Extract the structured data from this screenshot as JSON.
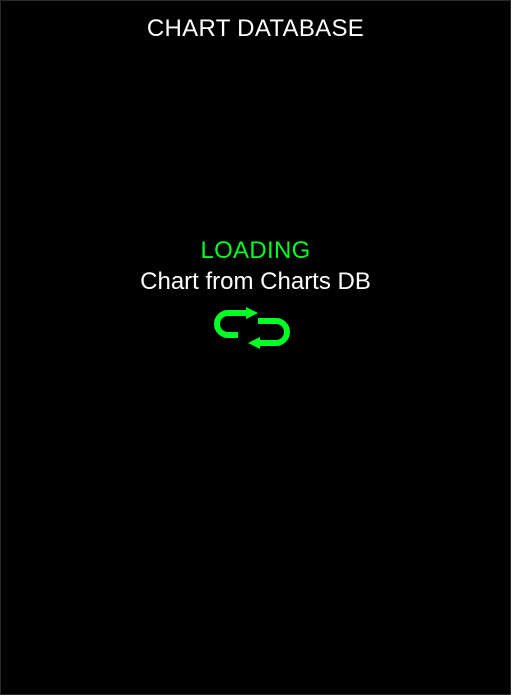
{
  "header": {
    "title": "CHART DATABASE"
  },
  "loading": {
    "status": "LOADING",
    "message": "Chart from Charts DB",
    "icon": "loading-cycle-arrows-icon"
  },
  "colors": {
    "background": "#000000",
    "accent": "#00ff22",
    "text": "#ffffff"
  }
}
